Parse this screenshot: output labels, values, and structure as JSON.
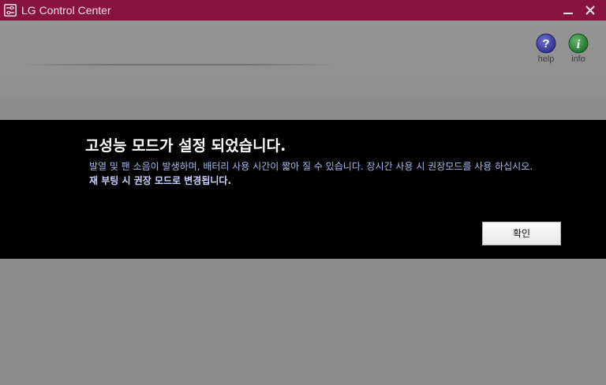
{
  "window": {
    "title": "LG Control Center",
    "icon": "lg-control-center-icon",
    "minimize_icon": "minimize-icon",
    "close_icon": "close-icon"
  },
  "header": {
    "help": {
      "label": "help",
      "icon": "help-question-icon",
      "color": "#3a3e9e"
    },
    "info": {
      "label": "info",
      "icon": "info-icon",
      "color": "#2f7f3a"
    }
  },
  "dialog": {
    "title": "고성능 모드가 설정 되었습니다.",
    "message": "발열 및 팬 소음이 발생하며, 배터리 사용 시간이 짧아 질 수 있습니다. 장시간 사용 시 권장모드를 사용 하십시오.",
    "message_emphasis": "재 부팅 시 권장 모드로 변경됩니다.",
    "confirm_label": "확인"
  },
  "colors": {
    "titlebar": "#86143f",
    "overlay_background": "#8d8d8d",
    "dialog_background": "#000000",
    "dialog_text": "#a8b8f0"
  }
}
